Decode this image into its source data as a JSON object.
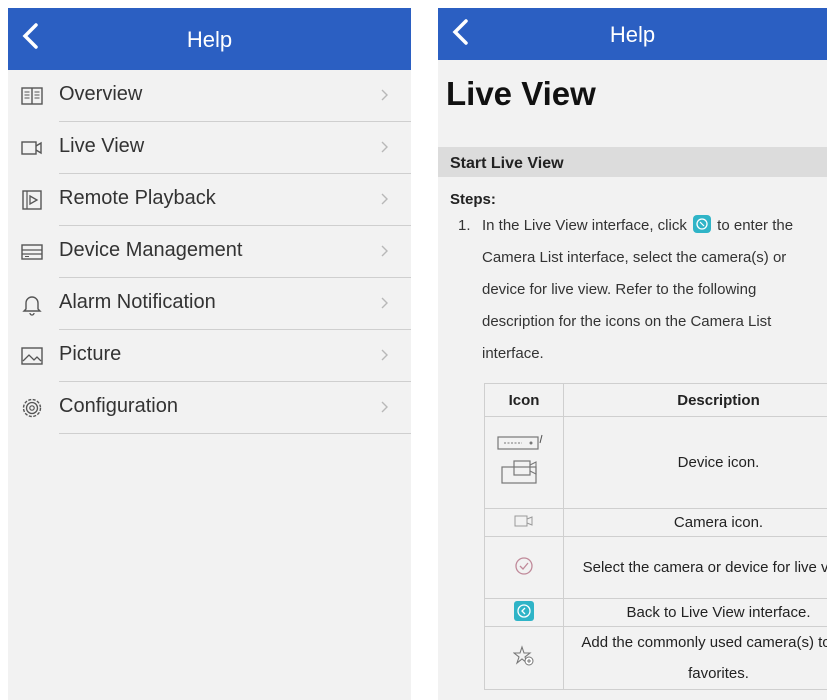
{
  "left": {
    "header": {
      "title": "Help"
    },
    "menu": [
      {
        "label": "Overview",
        "icon": "book-icon"
      },
      {
        "label": "Live View",
        "icon": "camera-icon"
      },
      {
        "label": "Remote Playback",
        "icon": "playback-icon"
      },
      {
        "label": "Device Management",
        "icon": "device-icon"
      },
      {
        "label": "Alarm Notification",
        "icon": "bell-icon"
      },
      {
        "label": "Picture",
        "icon": "picture-icon"
      },
      {
        "label": "Configuration",
        "icon": "gear-icon"
      }
    ]
  },
  "right": {
    "header": {
      "title": "Help"
    },
    "page_title": "Live View",
    "section": "Start Live View",
    "steps_label": "Steps:",
    "step1": {
      "number": "1.",
      "text_before": "In the Live View interface, click",
      "text_after": "to enter the Camera List interface, select the camera(s) or device for live view.",
      "text_ref": "Refer to the following description for the icons on the Camera List interface."
    },
    "table": {
      "headers": [
        "Icon",
        "Description"
      ],
      "rows": [
        {
          "icon": "device-icon",
          "desc": "Device icon."
        },
        {
          "icon": "camera-icon",
          "desc": "Camera icon."
        },
        {
          "icon": "check-circle-icon",
          "desc": "Select the camera or device for live view."
        },
        {
          "icon": "back-arrow-icon",
          "desc": "Back to Live View interface."
        },
        {
          "icon": "star-add-icon",
          "desc": "Add the commonly used camera(s) to the favorites."
        }
      ]
    }
  },
  "colors": {
    "header": "#2b5fc2",
    "accent": "#2fb4c7",
    "panel_bg": "#f2f2f2"
  }
}
